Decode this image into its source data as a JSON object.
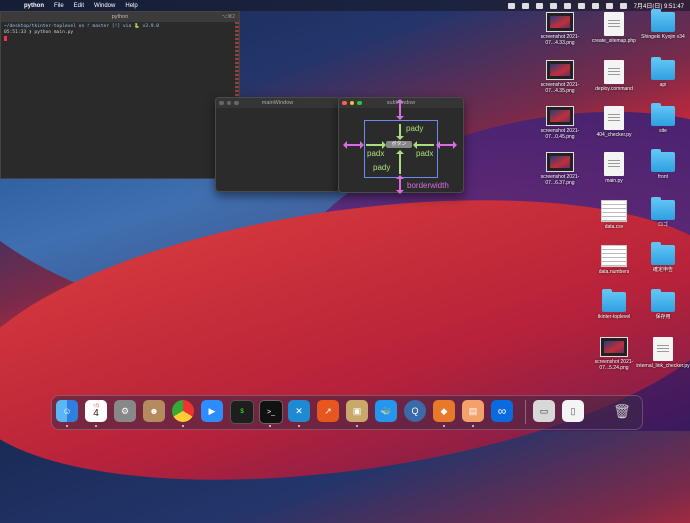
{
  "menubar": {
    "apple": "",
    "items": [
      "python",
      "File",
      "Edit",
      "Window",
      "Help"
    ],
    "clock": "7月4日(日) 9:51:47"
  },
  "terminal": {
    "title": "python",
    "shortcut": "⌥⌘2",
    "line1": "~/desktop/tkinter-toplevel on ᚠ master [!] via 🐍 v3.9.0",
    "line2": "05:51:33 ❯ python main.py"
  },
  "main_window": {
    "title": "mainWindow"
  },
  "sub_window": {
    "title": "subWindow",
    "button_label": "ボタン",
    "pady_top": "pady",
    "pady_bottom": "pady",
    "padx_left": "padx",
    "padx_right": "padx",
    "borderwidth": "borderwidth"
  },
  "desktop_icons": [
    {
      "label": "screenshot 2021-07...4.33.png",
      "kind": "shot"
    },
    {
      "label": "create_sitemap.php",
      "kind": "doc"
    },
    {
      "label": "Shingeki Kyojin v34",
      "kind": "folder"
    },
    {
      "label": "screenshot 2021-07...4.35.png",
      "kind": "shot"
    },
    {
      "label": "deploy.command",
      "kind": "doc"
    },
    {
      "label": "api",
      "kind": "folder"
    },
    {
      "label": "screenshot 2021-07...0.45.png",
      "kind": "shot"
    },
    {
      "label": "404_checker.py",
      "kind": "doc"
    },
    {
      "label": "site",
      "kind": "folder"
    },
    {
      "label": "screenshot 2021-07...6.37.png",
      "kind": "shot"
    },
    {
      "label": "main.py",
      "kind": "doc"
    },
    {
      "label": "front",
      "kind": "folder"
    },
    {
      "label": "data.csv",
      "kind": "sheet"
    },
    {
      "label": "ロゴ",
      "kind": "folder"
    },
    {
      "label": "data.numbers",
      "kind": "sheet"
    },
    {
      "label": "確定申告",
      "kind": "folder"
    },
    {
      "label": "tkinter-toplevel",
      "kind": "folder"
    },
    {
      "label": "保存用",
      "kind": "folder"
    },
    {
      "label": "screenshot 2021-07...5.24.png",
      "kind": "shot"
    },
    {
      "label": "internal_link_checker.py",
      "kind": "doc"
    }
  ],
  "dock": {
    "calendar_month": "7月",
    "calendar_day": "4",
    "items": [
      "finder-icon",
      "calendar-icon",
      "system-preferences-icon",
      "contacts-icon",
      "chrome-icon",
      "zoom-icon",
      "terminal-icon",
      "iterm-icon",
      "vscode-icon",
      "instruments-icon",
      "package-icon",
      "docker-icon",
      "quicktime-icon",
      "sourcetree-icon",
      "preview-icon",
      "infinity-icon",
      "screenshot-icon",
      "document-icon",
      "trash-icon"
    ]
  }
}
